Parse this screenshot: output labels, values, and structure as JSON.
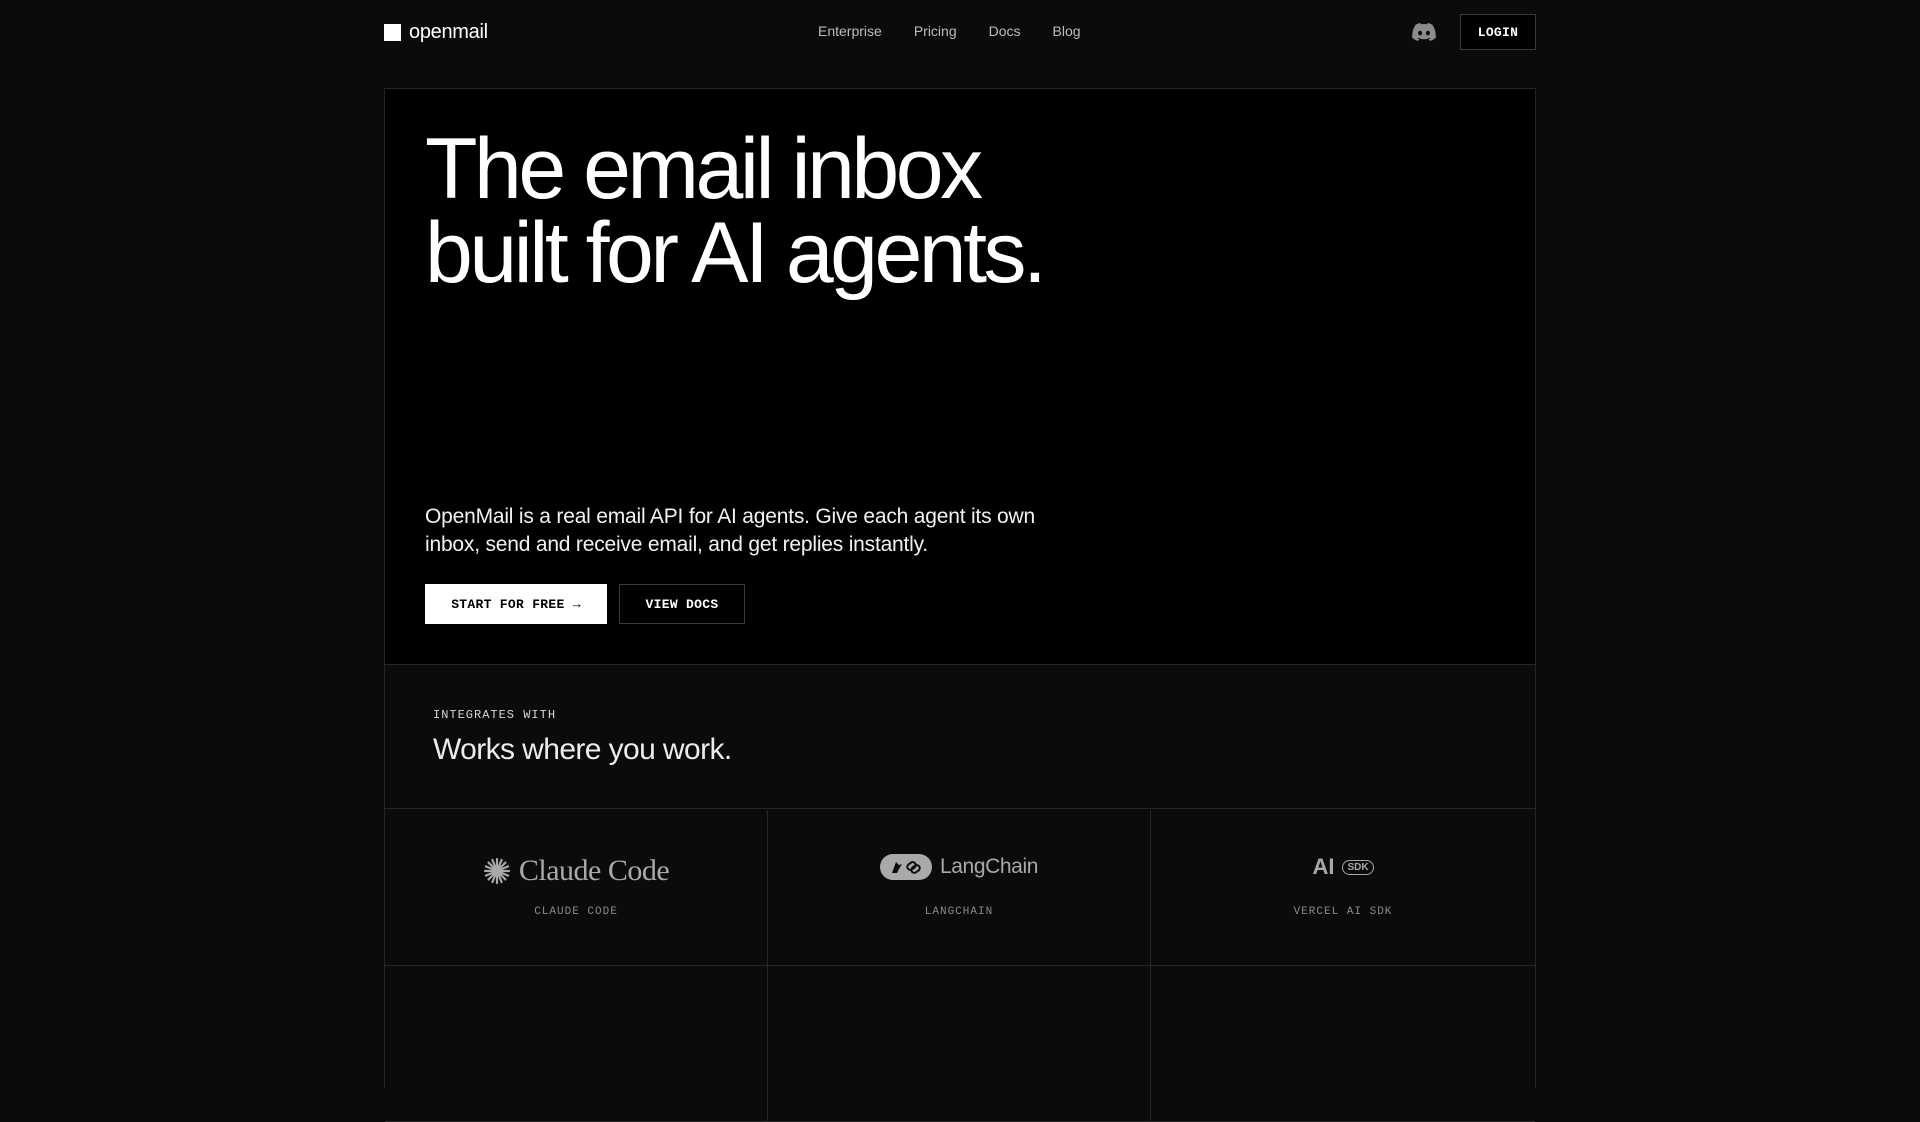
{
  "nav": {
    "brand": "openmail",
    "links": [
      "Enterprise",
      "Pricing",
      "Docs",
      "Blog"
    ],
    "discord_icon": "discord-icon",
    "login_label": "LOGIN"
  },
  "hero": {
    "title_line1": "The email inbox",
    "title_line2": "built for AI agents.",
    "subtitle": "OpenMail is a real email API for AI agents. Give each agent its own inbox, send and receive email, and get replies instantly.",
    "primary_cta": "START FOR FREE →",
    "secondary_cta": "VIEW DOCS"
  },
  "integrations": {
    "eyebrow": "INTEGRATES WITH",
    "title": "Works where you work.",
    "items": [
      {
        "logo_text": "Claude Code",
        "label": "CLAUDE CODE",
        "icon": "claude-starburst-icon"
      },
      {
        "logo_text": "LangChain",
        "label": "LANGCHAIN",
        "icon": "langchain-parrot-link-icon"
      },
      {
        "logo_text": "AI",
        "logo_badge": "SDK",
        "label": "VERCEL AI SDK",
        "icon": "vercel-ai-sdk-icon"
      }
    ]
  },
  "colors": {
    "background": "#0b0b0b",
    "hero_background": "#000000",
    "border": "#262626",
    "text": "#ffffff",
    "muted": "#a9a9a9"
  }
}
